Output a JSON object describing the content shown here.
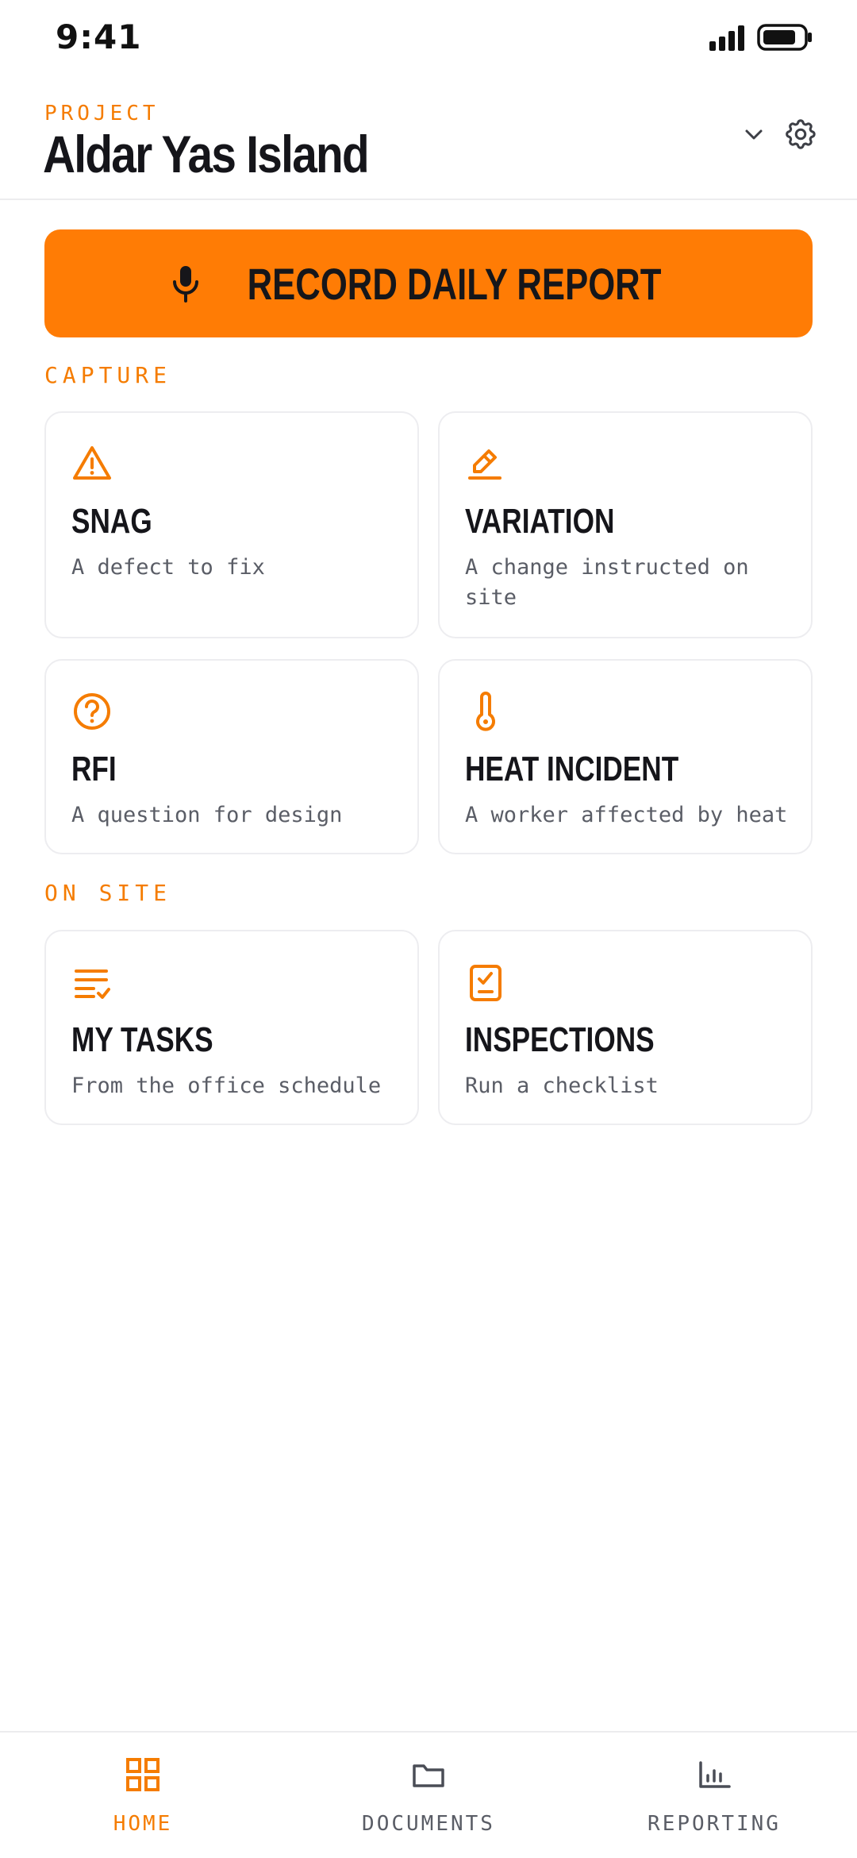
{
  "status_bar": {
    "time": "9:41"
  },
  "header": {
    "project_label": "PROJECT",
    "project_name": "Aldar Yas Island"
  },
  "record_button": {
    "label": "RECORD DAILY REPORT",
    "icon": "mic-icon"
  },
  "sections": {
    "capture": "CAPTURE",
    "on_site": "ON SITE"
  },
  "cards": {
    "snag": {
      "title": "SNAG",
      "subtitle": "A defect to fix",
      "icon": "warning-triangle-icon"
    },
    "variation": {
      "title": "VARIATION",
      "subtitle": "A change instructed on site",
      "icon": "edit-pencil-icon"
    },
    "rfi": {
      "title": "RFI",
      "subtitle": "A question for design",
      "icon": "question-circle-icon"
    },
    "heat": {
      "title": "HEAT INCIDENT",
      "subtitle": "A worker affected by heat",
      "icon": "thermometer-icon"
    },
    "tasks": {
      "title": "MY TASKS",
      "subtitle": "From the office schedule",
      "icon": "task-list-icon"
    },
    "inspections": {
      "title": "INSPECTIONS",
      "subtitle": "Run a checklist",
      "icon": "clipboard-check-icon"
    }
  },
  "bottom_nav": {
    "items": [
      {
        "label": "HOME",
        "icon": "grid-icon",
        "active": true
      },
      {
        "label": "DOCUMENTS",
        "icon": "folder-icon",
        "active": false
      },
      {
        "label": "REPORTING",
        "icon": "bar-chart-icon",
        "active": false
      }
    ]
  },
  "colors": {
    "accent": "#ff7c05",
    "accent_text": "#f57c00",
    "title": "#15151a",
    "muted": "#5a5d66",
    "border": "#ededf0"
  }
}
